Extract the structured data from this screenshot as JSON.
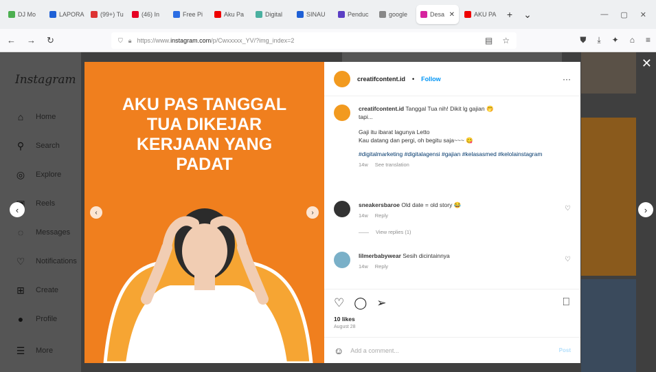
{
  "browser": {
    "tabs": [
      {
        "label": "DJ Mo",
        "color": "#4caf50"
      },
      {
        "label": "LAPORA",
        "color": "#1e60d6"
      },
      {
        "label": "(99+) Tu",
        "color": "#d33"
      },
      {
        "label": "(46) In",
        "color": "#e60023"
      },
      {
        "label": "Free Pi",
        "color": "#2b6de3"
      },
      {
        "label": "Aku Pa",
        "color": "#e00"
      },
      {
        "label": "Digital",
        "color": "#4ab0a0"
      },
      {
        "label": "SINAU",
        "color": "#1e60d6"
      },
      {
        "label": "Penduc",
        "color": "#5b3fc4"
      },
      {
        "label": "google",
        "color": "#888"
      },
      {
        "label": "Desa",
        "color": "#d6249f"
      },
      {
        "label": "AKU PA",
        "color": "#e00"
      }
    ],
    "active_tab_index": 10,
    "url_prefix": "https://www.",
    "url_host": "instagram.com",
    "url_path": "/p/Cwxxxxx_YV/?img_index=2"
  },
  "sidebar": {
    "logo": "Instagram",
    "items": [
      {
        "label": "Home",
        "icon": "⌂"
      },
      {
        "label": "Search",
        "icon": "⚲"
      },
      {
        "label": "Explore",
        "icon": "◎"
      },
      {
        "label": "Reels",
        "icon": "▣"
      },
      {
        "label": "Messages",
        "icon": "◌"
      },
      {
        "label": "Notifications",
        "icon": "♡"
      },
      {
        "label": "Create",
        "icon": "⊞"
      },
      {
        "label": "Profile",
        "icon": "●"
      },
      {
        "label": "More",
        "icon": "☰"
      }
    ]
  },
  "post": {
    "headline": [
      "AKU PAS TANGGAL",
      "TUA DIKEJAR",
      "KERJAAN YANG",
      "PADAT"
    ],
    "username": "creatifcontent.id",
    "follow_label": "Follow",
    "caption_user": "creatifcontent.id",
    "caption_line1": "Tanggal Tua nih! Dikit lg gajian 🤭",
    "caption_line2": "tapi...",
    "caption_line3": "Gaji itu ibarat lagunya Letto",
    "caption_line4": "Kau datang dan pergi, oh begitu saja~~~ 😋",
    "hashtags": "#digitalmarketing #digitalagensi #gajian #kelasasmed #kelolainstagram",
    "caption_time": "14w",
    "see_translation": "See translation",
    "comments": [
      {
        "user": "sneakersbaroe",
        "text": "Old date = old story 😂",
        "time": "14w",
        "reply": "Reply",
        "view_replies": "View replies (1)"
      },
      {
        "user": "lilmerbabywear",
        "text": "Sesih dicintainnya",
        "time": "14w",
        "reply": "Reply"
      }
    ],
    "likes": "10 likes",
    "date": "August 28",
    "add_comment_placeholder": "Add a comment...",
    "post_label": "Post"
  }
}
